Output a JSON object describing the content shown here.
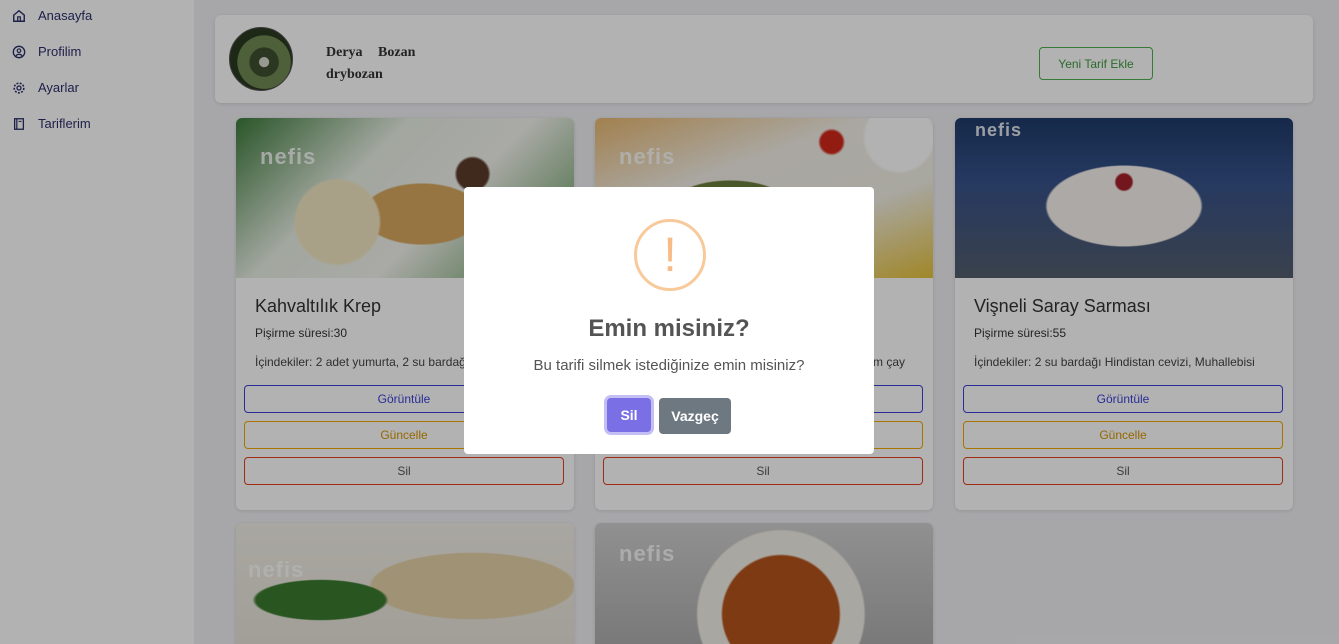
{
  "sidebar": {
    "items": [
      {
        "label": "Anasayfa",
        "icon": "home-icon"
      },
      {
        "label": "Profilim",
        "icon": "user-circle-icon"
      },
      {
        "label": "Ayarlar",
        "icon": "gear-icon"
      },
      {
        "label": "Tariflerim",
        "icon": "book-icon"
      }
    ]
  },
  "profile": {
    "name": "Derya Bozan",
    "username": "drybozan",
    "add_button": "Yeni Tarif Ekle"
  },
  "recipes": [
    {
      "title": "Kahvaltılık Krep",
      "time": "Pişirme süresi:30",
      "ingredients": "İçindekiler: 2 adet yumurta, 2 su bardağı",
      "view": "Görüntüle",
      "update": "Güncelle",
      "delete": "Sil"
    },
    {
      "title": "",
      "time": "",
      "ingredients": "m çay",
      "view": "",
      "update": "",
      "delete": "Sil"
    },
    {
      "title": "Vişneli Saray Sarması",
      "time": "Pişirme süresi:55",
      "ingredients": "İçindekiler: 2 su bardağı Hindistan cevizi, Muhallebisi",
      "view": "Görüntüle",
      "update": "Güncelle",
      "delete": "Sil"
    }
  ],
  "watermark": "nefis",
  "modal": {
    "icon": "!",
    "title": "Emin misiniz?",
    "text": "Bu tarifi silmek istediğinize emin misiniz?",
    "confirm": "Sil",
    "cancel": "Vazgeç"
  },
  "colors": {
    "accent": "#7b6fe6",
    "cancel": "#6e7881",
    "warning": "#f8bb86",
    "view_border": "#3b3fd8",
    "update_border": "#f0a800",
    "delete_border": "#e53e1e",
    "add_border": "#4caf50"
  }
}
